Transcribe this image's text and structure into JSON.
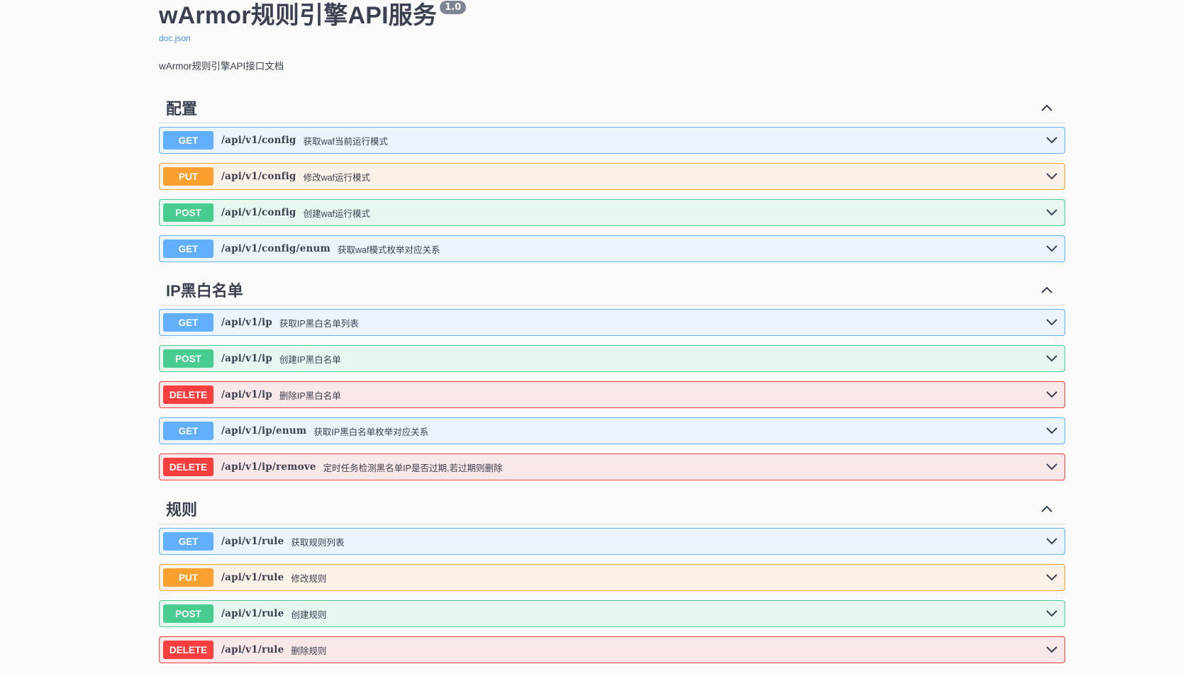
{
  "info": {
    "title": "wArmor规则引擎API服务",
    "version": "1.0",
    "doc_link": "doc.json",
    "description": "wArmor规则引擎API接口文档"
  },
  "tags": [
    {
      "name": "配置",
      "operations": [
        {
          "method": "GET",
          "path": "/api/v1/config",
          "summary": "获取waf当前运行模式"
        },
        {
          "method": "PUT",
          "path": "/api/v1/config",
          "summary": "修改waf运行模式"
        },
        {
          "method": "POST",
          "path": "/api/v1/config",
          "summary": "创建waf运行模式"
        },
        {
          "method": "GET",
          "path": "/api/v1/config/enum",
          "summary": "获取waf模式枚举对应关系"
        }
      ]
    },
    {
      "name": "IP黑白名单",
      "operations": [
        {
          "method": "GET",
          "path": "/api/v1/ip",
          "summary": "获取IP黑白名单列表"
        },
        {
          "method": "POST",
          "path": "/api/v1/ip",
          "summary": "创建IP黑白名单"
        },
        {
          "method": "DELETE",
          "path": "/api/v1/ip",
          "summary": "删除IP黑白名单"
        },
        {
          "method": "GET",
          "path": "/api/v1/ip/enum",
          "summary": "获取IP黑白名单枚举对应关系"
        },
        {
          "method": "DELETE",
          "path": "/api/v1/ip/remove",
          "summary": "定时任务检测黑名单IP是否过期,若过期则删除"
        }
      ]
    },
    {
      "name": "规则",
      "operations": [
        {
          "method": "GET",
          "path": "/api/v1/rule",
          "summary": "获取规则列表"
        },
        {
          "method": "PUT",
          "path": "/api/v1/rule",
          "summary": "修改规则"
        },
        {
          "method": "POST",
          "path": "/api/v1/rule",
          "summary": "创建规则"
        },
        {
          "method": "DELETE",
          "path": "/api/v1/rule",
          "summary": "删除规则"
        }
      ]
    }
  ],
  "colors": {
    "get": "#61affe",
    "put": "#fca130",
    "post": "#49cc90",
    "delete": "#f93e3e"
  },
  "icons": {
    "tag_toggle": "chevron-up-icon",
    "operation_expand": "chevron-down-icon"
  }
}
